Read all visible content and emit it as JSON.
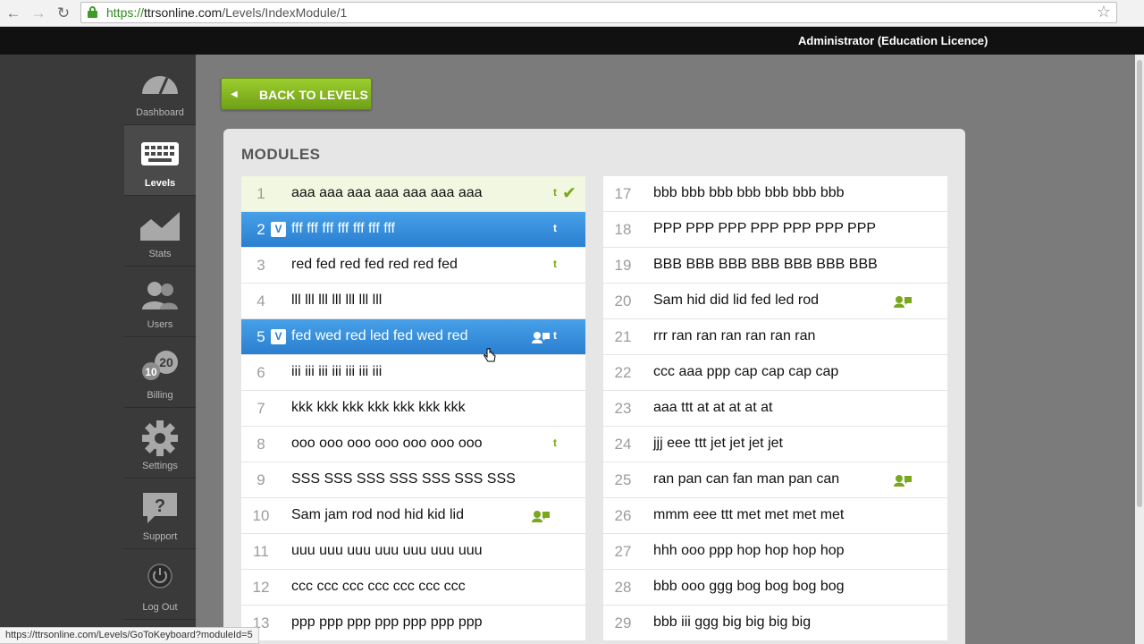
{
  "browser": {
    "url_protocol": "https://",
    "url_host": "ttrsonline.com",
    "url_path": "/Levels/IndexModule/1",
    "status_url": "https://ttrsonline.com/Levels/GoToKeyboard?moduleId=5"
  },
  "header": {
    "user": "Administrator (Education Licence)"
  },
  "sidebar": {
    "items": [
      {
        "label": "Dashboard",
        "icon": "gauge-icon"
      },
      {
        "label": "Levels",
        "icon": "keyboard-icon",
        "active": true
      },
      {
        "label": "Stats",
        "icon": "area-chart-icon"
      },
      {
        "label": "Users",
        "icon": "users-icon"
      },
      {
        "label": "Billing",
        "icon": "coins-icon",
        "coin_big": "20",
        "coin_small": "10"
      },
      {
        "label": "Settings",
        "icon": "gear-icon"
      },
      {
        "label": "Support",
        "icon": "question-bubble-icon",
        "glyph": "?"
      },
      {
        "label": "Log Out",
        "icon": "power-icon"
      }
    ]
  },
  "back_button": {
    "label": "BACK TO LEVELS"
  },
  "modules_title": "MODULES",
  "badges": {
    "t": "t",
    "v": "V"
  },
  "modules_left": [
    {
      "num": "1",
      "text": "aaa aaa aaa aaa aaa aaa aaa",
      "state": "done",
      "t": true,
      "check": true
    },
    {
      "num": "2",
      "text": "fff fff fff fff fff fff fff",
      "state": "selected",
      "v": true,
      "t": true
    },
    {
      "num": "3",
      "text": "red fed red fed red red fed",
      "t": true
    },
    {
      "num": "4",
      "text": "lll lll lll lll lll lll lll"
    },
    {
      "num": "5",
      "text": "fed wed red led fed wed red",
      "state": "selected",
      "v": true,
      "t": true,
      "user": true
    },
    {
      "num": "6",
      "text": "iii iii iii iii iii iii iii"
    },
    {
      "num": "7",
      "text": "kkk kkk kkk kkk kkk kkk kkk"
    },
    {
      "num": "8",
      "text": "ooo ooo ooo ooo ooo ooo ooo",
      "t": true
    },
    {
      "num": "9",
      "text": "SSS SSS SSS SSS SSS SSS SSS"
    },
    {
      "num": "10",
      "text": "Sam jam rod nod hid kid lid",
      "user": true
    },
    {
      "num": "11",
      "text": "uuu uuu uuu uuu uuu uuu uuu"
    },
    {
      "num": "12",
      "text": "ccc ccc ccc ccc ccc ccc ccc"
    },
    {
      "num": "13",
      "text": "ppp ppp ppp ppp ppp ppp ppp"
    }
  ],
  "modules_right": [
    {
      "num": "17",
      "text": "bbb bbb bbb bbb bbb bbb bbb"
    },
    {
      "num": "18",
      "text": "PPP PPP PPP PPP PPP PPP PPP"
    },
    {
      "num": "19",
      "text": "BBB BBB BBB BBB BBB BBB BBB"
    },
    {
      "num": "20",
      "text": "Sam hid did lid fed led rod",
      "user": true
    },
    {
      "num": "21",
      "text": "rrr ran ran ran ran ran ran"
    },
    {
      "num": "22",
      "text": "ccc aaa ppp cap cap cap cap"
    },
    {
      "num": "23",
      "text": "aaa ttt at at at at at"
    },
    {
      "num": "24",
      "text": "jjj eee ttt jet jet jet jet"
    },
    {
      "num": "25",
      "text": "ran pan can fan man pan can",
      "user": true
    },
    {
      "num": "26",
      "text": "mmm eee ttt met met met met"
    },
    {
      "num": "27",
      "text": "hhh ooo ppp hop hop hop hop"
    },
    {
      "num": "28",
      "text": "bbb ooo ggg bog bog bog bog"
    },
    {
      "num": "29",
      "text": "bbb iii ggg big big big big"
    }
  ],
  "colors": {
    "accent_green": "#7aa81c",
    "selected_blue": "#2a7fd0",
    "done_bg": "#f1f7e0"
  }
}
